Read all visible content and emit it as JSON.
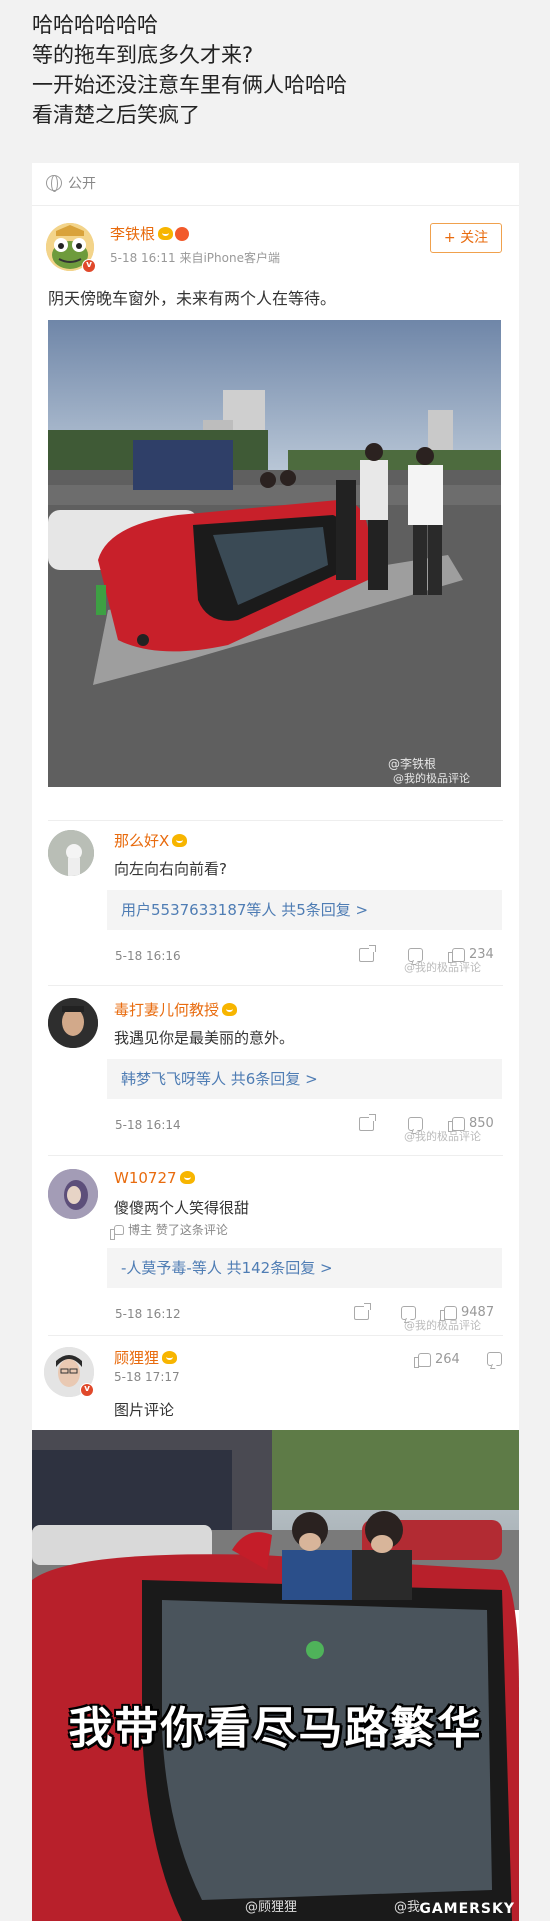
{
  "post": {
    "lines": [
      "哈哈哈哈哈哈",
      "等的拖车到底多久才来?",
      "一开始还没注意车里有俩人哈哈哈",
      "看清楚之后笑疯了"
    ]
  },
  "visibility": "公开",
  "weibo": {
    "author": "李铁根",
    "meta": "5-18 16:11 来自iPhone客户端",
    "follow_label": "+ 关注",
    "text": "阴天傍晚车窗外，未来有两个人在等待。",
    "watermark_1": "@李铁根",
    "watermark_2": "@我的极品评论"
  },
  "comments": [
    {
      "name": "那么好X",
      "text": "向左向右向前看?",
      "reply": "用户5537633187等人  共5条回复 >",
      "time": "5-18 16:16",
      "likes": "234",
      "watermark": "@我的极品评论"
    },
    {
      "name": "毒打妻儿何教授",
      "text": "我遇见你是最美丽的意外。",
      "reply": "韩梦飞飞呀等人  共6条回复 >",
      "time": "5-18 16:14",
      "likes": "850",
      "watermark": "@我的极品评论"
    },
    {
      "name": "W10727",
      "text": "傻傻两个人笑得很甜",
      "liked_by": "博主 赞了这条评论",
      "reply": "-人莫予毒-等人  共142条回复 >",
      "time": "5-18 16:12",
      "likes": "9487",
      "watermark": "@我的极品评论"
    },
    {
      "name": "顾狸狸",
      "time": "5-18 17:17",
      "likes": "264",
      "text": "图片评论"
    }
  ],
  "meme": {
    "caption": "我带你看尽马路繁华",
    "watermark_1": "@顾狸狸",
    "watermark_2": "@我",
    "site_mark": "GAMERSKY"
  },
  "colors": {
    "name_orange": "#e86b0e",
    "link_blue": "#4f7db4",
    "car_red": "#c8202a"
  }
}
